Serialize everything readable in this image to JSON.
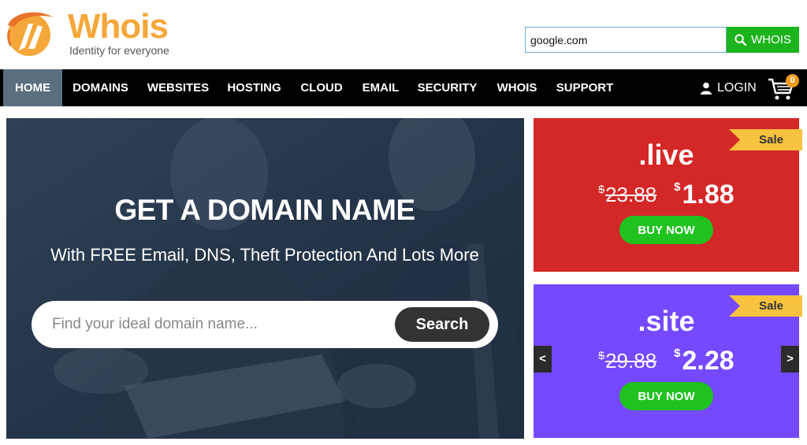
{
  "brand": {
    "name": "Whois",
    "tagline": "Identity for everyone",
    "color": "#f5a73a"
  },
  "whois_search": {
    "value": "google.com",
    "button_label": "WHOIS",
    "button_icon": "search-icon",
    "button_color": "#1cb41c"
  },
  "nav": {
    "items": [
      {
        "label": "HOME",
        "active": true
      },
      {
        "label": "DOMAINS",
        "active": false
      },
      {
        "label": "WEBSITES",
        "active": false
      },
      {
        "label": "HOSTING",
        "active": false
      },
      {
        "label": "CLOUD",
        "active": false
      },
      {
        "label": "EMAIL",
        "active": false
      },
      {
        "label": "SECURITY",
        "active": false
      },
      {
        "label": "WHOIS",
        "active": false
      },
      {
        "label": "SUPPORT",
        "active": false
      }
    ],
    "login_label": "LOGIN",
    "login_icon": "user-icon",
    "cart_icon": "cart-icon",
    "cart_count": "0"
  },
  "hero": {
    "title": "GET A DOMAIN NAME",
    "subtitle": "With FREE Email, DNS, Theft Protection And Lots More",
    "search_placeholder": "Find your ideal domain name...",
    "search_button": "Search"
  },
  "promos": [
    {
      "ribbon": "Sale",
      "tld": ".live",
      "currency": "$",
      "old_price": "23.88",
      "new_price": "1.88",
      "button": "BUY NOW",
      "color": "#d42727"
    },
    {
      "ribbon": "Sale",
      "tld": ".site",
      "currency": "$",
      "old_price": "29.88",
      "new_price": "2.28",
      "button": "BUY NOW",
      "color": "#7549ff"
    }
  ],
  "carousel": {
    "prev_label": "<",
    "next_label": ">"
  }
}
